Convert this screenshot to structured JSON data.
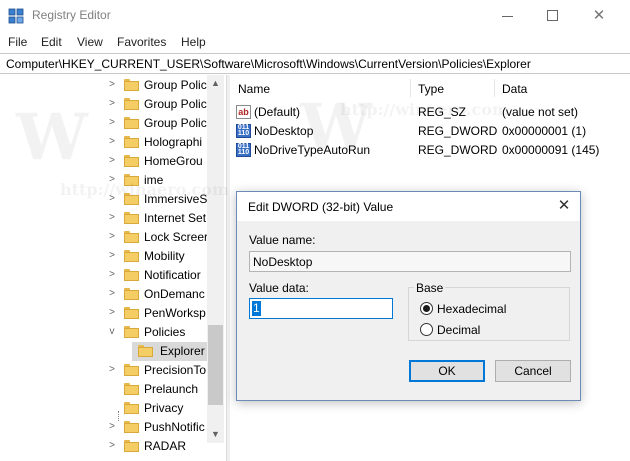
{
  "window": {
    "title": "Registry Editor",
    "controls": {
      "minimize": "minimize",
      "maximize": "maximize",
      "close": "✕"
    }
  },
  "menu": [
    "File",
    "Edit",
    "View",
    "Favorites",
    "Help"
  ],
  "address": "Computer\\HKEY_CURRENT_USER\\Software\\Microsoft\\Windows\\CurrentVersion\\Policies\\Explorer",
  "tree": {
    "items": [
      {
        "label": "Group Polic",
        "expand": ">"
      },
      {
        "label": "Group Polic",
        "expand": ">"
      },
      {
        "label": "Group Polic",
        "expand": ">"
      },
      {
        "label": "Holographi",
        "expand": ">"
      },
      {
        "label": "HomeGrou",
        "expand": ">"
      },
      {
        "label": "ime",
        "expand": ">"
      },
      {
        "label": "ImmersiveS",
        "expand": ">"
      },
      {
        "label": "Internet Set",
        "expand": ">"
      },
      {
        "label": "Lock Screer",
        "expand": ">"
      },
      {
        "label": "Mobility",
        "expand": ">"
      },
      {
        "label": "Notificatior",
        "expand": ">"
      },
      {
        "label": "OnDemanc",
        "expand": ">"
      },
      {
        "label": "PenWorksp",
        "expand": ">"
      },
      {
        "label": "Policies",
        "expand": "v"
      },
      {
        "label": "Explorer",
        "expand": ""
      },
      {
        "label": "PrecisionTo",
        "expand": ">"
      },
      {
        "label": "Prelaunch",
        "expand": ""
      },
      {
        "label": "Privacy",
        "expand": ""
      },
      {
        "label": "PushNotific",
        "expand": ">"
      },
      {
        "label": "RADAR",
        "expand": ">"
      }
    ],
    "scroll_up": "▲",
    "scroll_down": "▼"
  },
  "list": {
    "columns": [
      "Name",
      "Type",
      "Data"
    ],
    "rows": [
      {
        "icon": "ab",
        "name": "(Default)",
        "type": "REG_SZ",
        "data": "(value not set)"
      },
      {
        "icon": "011 110",
        "name": "NoDesktop",
        "type": "REG_DWORD",
        "data": "0x00000001 (1)"
      },
      {
        "icon": "011 110",
        "name": "NoDriveTypeAutoRun",
        "type": "REG_DWORD",
        "data": "0x00000091 (145)"
      }
    ]
  },
  "dialog": {
    "title": "Edit DWORD (32-bit) Value",
    "close": "✕",
    "value_name_label": "Value name:",
    "value_name": "NoDesktop",
    "value_data_label": "Value data:",
    "value_data": "1",
    "base_label": "Base",
    "base_options": [
      {
        "label": "Hexadecimal",
        "selected": true
      },
      {
        "label": "Decimal",
        "selected": false
      }
    ],
    "ok_label": "OK",
    "cancel_label": "Cancel"
  },
  "watermark": "http://winaero.com",
  "colors": {
    "accent": "#0078d7",
    "folder": "#f4cd64",
    "selection_gray": "#d9d9d9",
    "dialog_bg": "#f0f0f0"
  }
}
